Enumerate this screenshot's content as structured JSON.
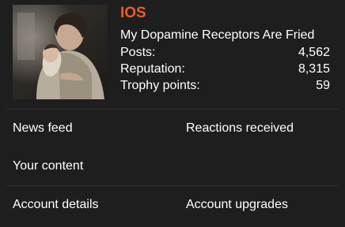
{
  "accent_color": "#f05a28",
  "profile": {
    "username": "IOS",
    "user_title": "My Dopamine Receptors Are Fried",
    "stats": [
      {
        "label": "Posts:",
        "value": "4,562"
      },
      {
        "label": "Reputation:",
        "value": "8,315"
      },
      {
        "label": "Trophy points:",
        "value": "59"
      }
    ]
  },
  "menu": {
    "news_feed": "News feed",
    "reactions_received": "Reactions received",
    "your_content": "Your content",
    "account_details": "Account details",
    "account_upgrades": "Account upgrades"
  }
}
